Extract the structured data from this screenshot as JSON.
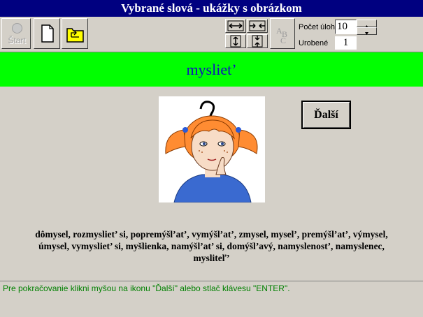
{
  "window": {
    "title": "Vybrané slová - ukážky s obrázkom"
  },
  "toolbar": {
    "start_label": "Štart",
    "new_icon": "new-document-icon",
    "open_icon": "open-folder-icon",
    "abc_icon": "spell-abc-icon",
    "task_count_label": "Počet úloh",
    "task_count_value": "10",
    "done_label": "Urobené",
    "done_value": "1"
  },
  "main": {
    "word": "mysliet’",
    "picture_icon": "thinking-girl-picture",
    "next_label": "Ďalší",
    "related_words": "dômysel, rozmysliet’ si, popremýšl’at’, vymýšl’at’, zmysel, mysel’, premýšl’at’, výmysel, úmysel, vymysliet’ si, myšlienka, namýšl’at’ si, domýšl’avý, namyslenost’, namyslenec, mysliteľ’"
  },
  "status": {
    "text": "Pre pokračovanie klikni myšou na ikonu \"Ďalší\" alebo stlač klávesu \"ENTER\"."
  },
  "colors": {
    "title_bg": "#000080",
    "word_bar": "#00ff00",
    "word_text": "#1010c0",
    "status_text": "#008000"
  }
}
